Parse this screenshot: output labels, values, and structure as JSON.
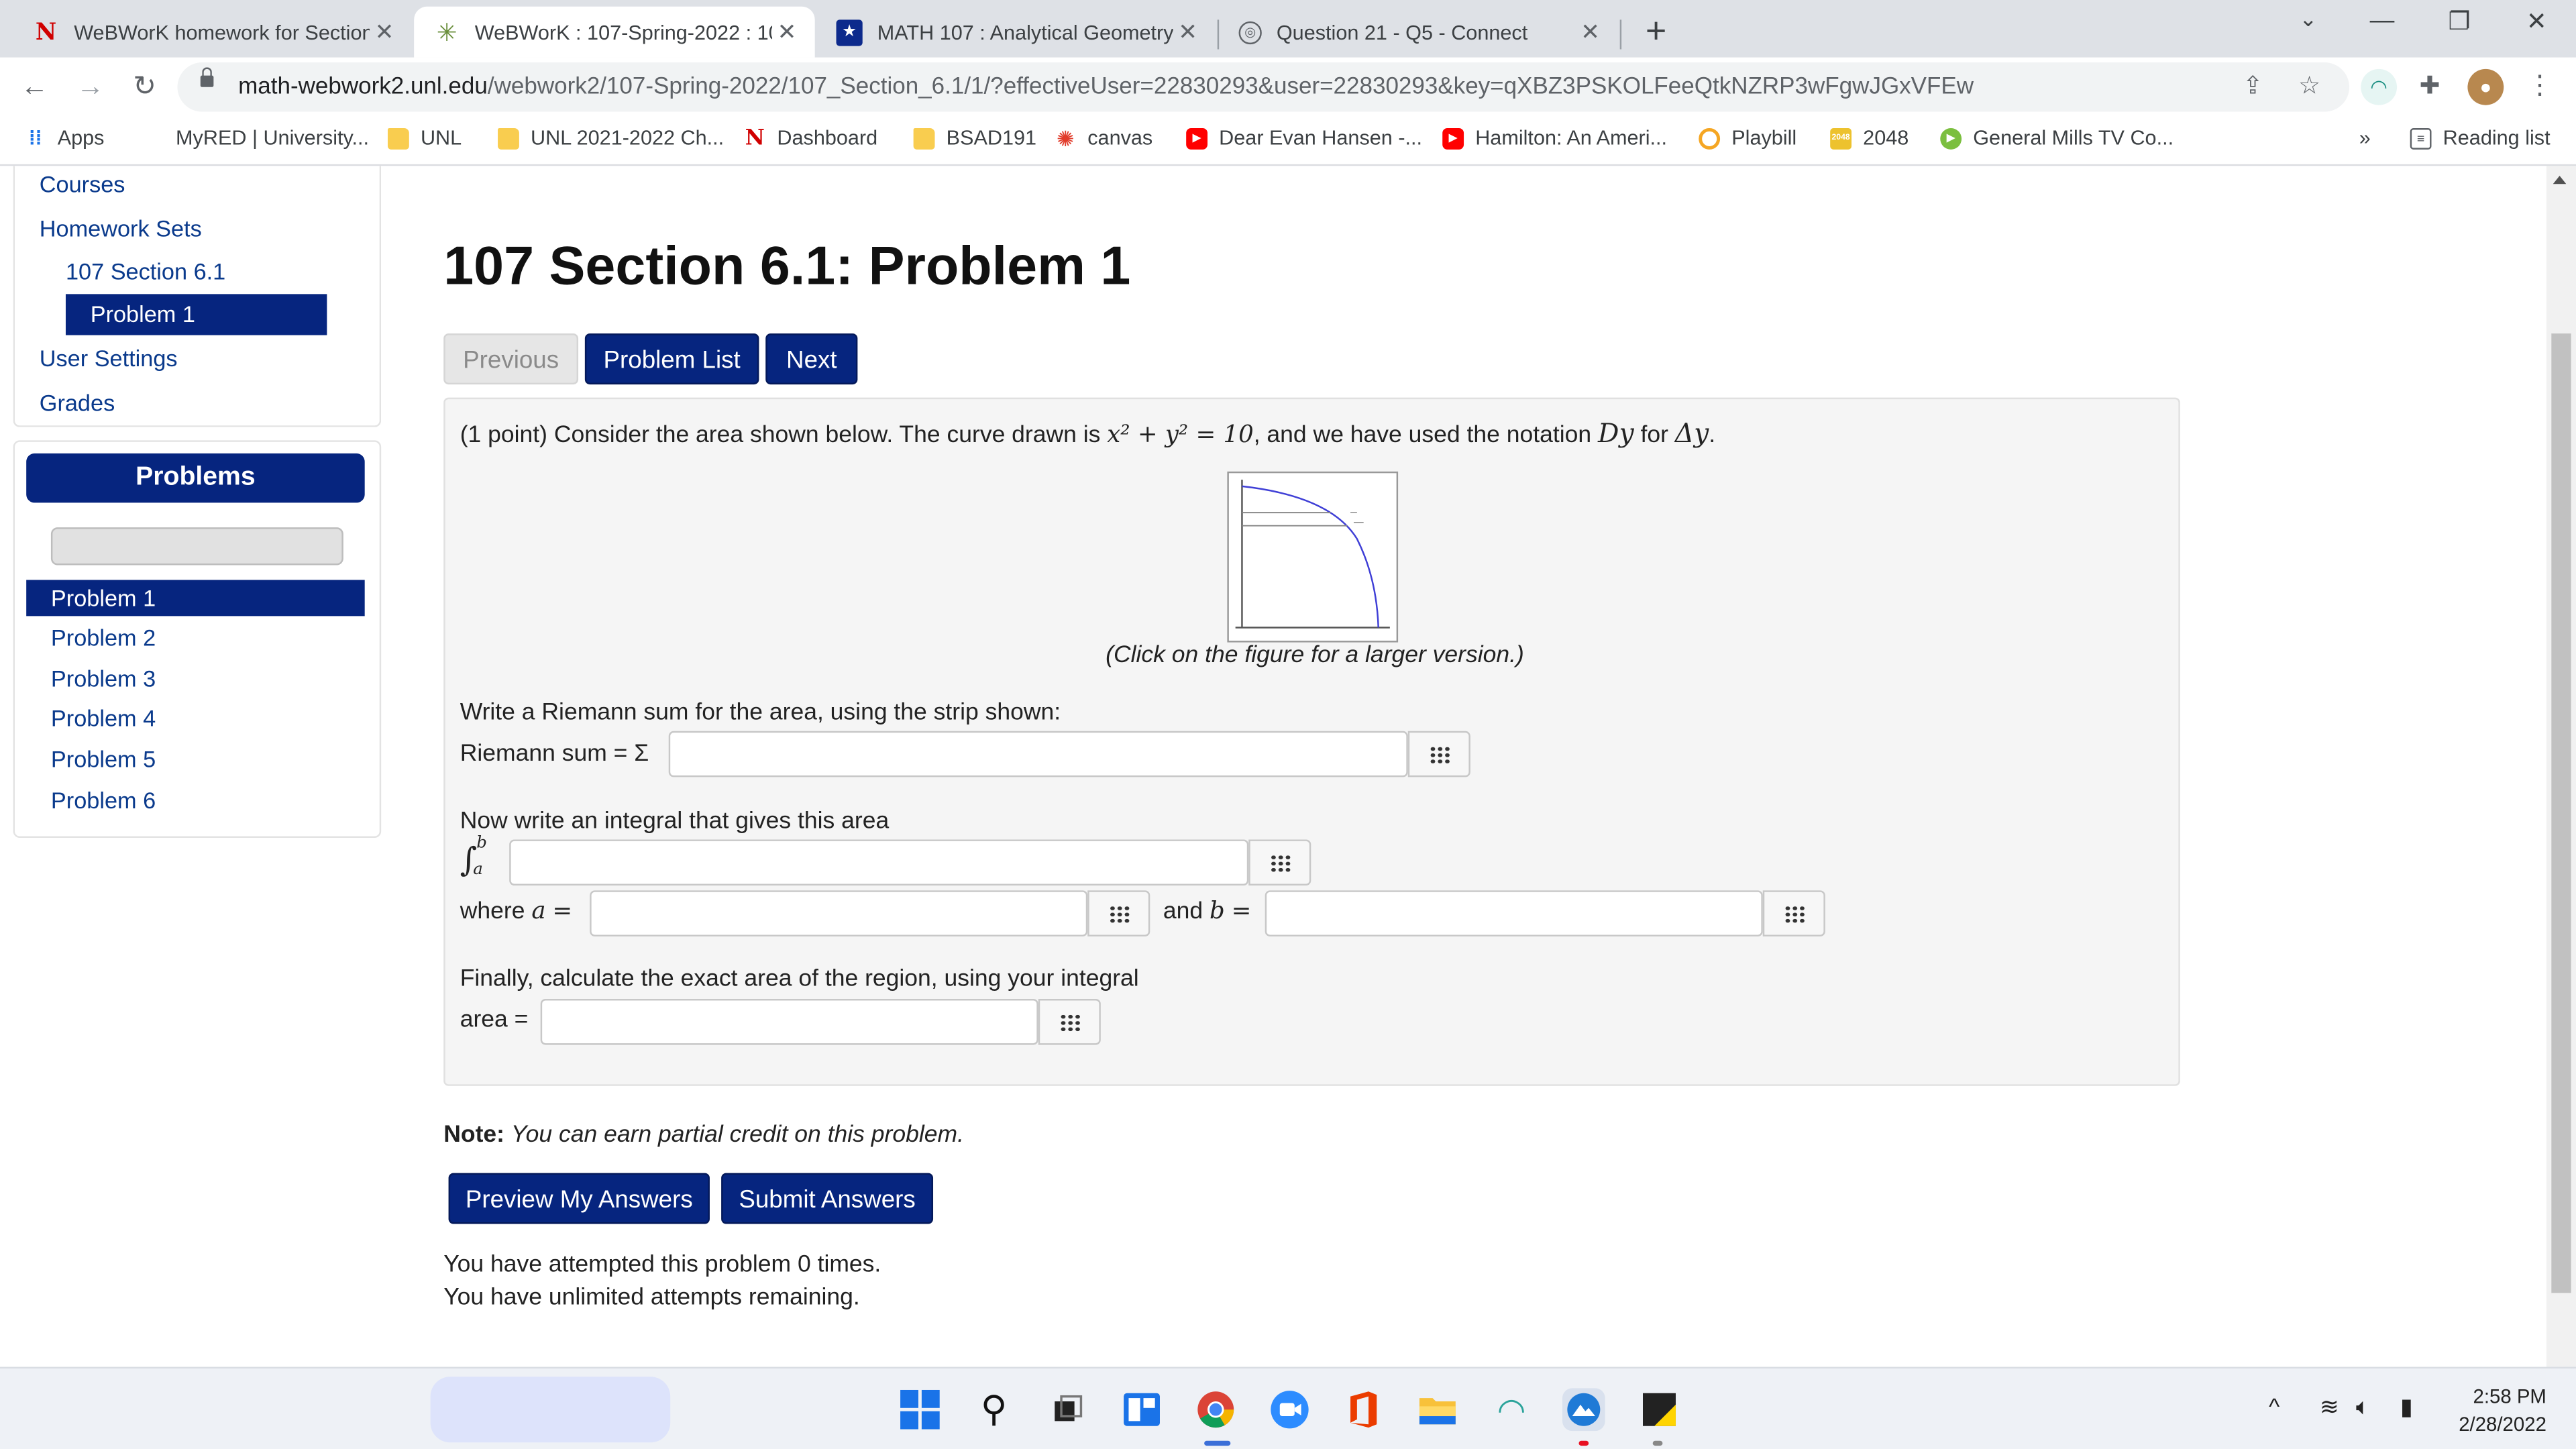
{
  "colors": {
    "nav_blue": "#06257f",
    "link_blue": "#0a3a8c",
    "tab_strip": "#dee1e6"
  },
  "tabs": [
    {
      "title": "WeBWorK homework for Section",
      "icon": "n-logo-icon",
      "active": false
    },
    {
      "title": "WeBWorK : 107-Spring-2022 : 10",
      "icon": "webwork-icon",
      "active": true
    },
    {
      "title": "MATH 107 : Analytical Geometry",
      "icon": "star-badge-icon",
      "active": false
    },
    {
      "title": "Question 21 - Q5 - Connect",
      "icon": "globe-icon",
      "active": false
    }
  ],
  "address": {
    "host": "math-webwork2.unl.edu",
    "path": "/webwork2/107-Spring-2022/107_Section_6.1/1/?effectiveUser=22830293&user=22830293&key=qXBZ3PSKOLFeeQtkNZRP3wFgwJGxVFEw"
  },
  "bookmarks": {
    "apps": "Apps",
    "items": [
      "MyRED | University...",
      "UNL",
      "UNL 2021-2022 Ch...",
      "Dashboard",
      "BSAD191",
      "canvas",
      "Dear Evan Hansen -...",
      "Hamilton: An Ameri...",
      "Playbill",
      "2048",
      "General Mills TV Co..."
    ],
    "more": "»",
    "reading_list": "Reading list"
  },
  "sidebar": {
    "courses": "Courses",
    "homework_sets": "Homework Sets",
    "section": "107 Section 6.1",
    "problem": "Problem 1",
    "user_settings": "User Settings",
    "grades": "Grades"
  },
  "problems_panel": {
    "heading": "Problems",
    "items": [
      "Problem 1",
      "Problem 2",
      "Problem 3",
      "Problem 4",
      "Problem 5",
      "Problem 6"
    ]
  },
  "main": {
    "title": "107 Section 6.1: Problem 1",
    "prev": "Previous",
    "list": "Problem List",
    "next": "Next",
    "intro_pre": "(1 point) Consider the area shown below. The curve drawn is ",
    "equation": "x² + y² = 10",
    "intro_mid": ", and we have used the notation ",
    "notation_dy": "Dy",
    "intro_for": " for ",
    "notation_delta": "Δy",
    "intro_end": ".",
    "caption": "(Click on the figure for a larger version.)",
    "riemann_prompt": "Write a Riemann sum for the area, using the strip shown:",
    "riemann_label": "Riemann sum = Σ",
    "integral_prompt": "Now write an integral that gives this area",
    "integral_symbol": "∫",
    "upper_limit": "b",
    "lower_limit": "a",
    "where_label": "where",
    "var_a": "a",
    "eq": "=",
    "and_label": "and",
    "var_b": "b",
    "area_prompt": "Finally, calculate the exact area of the region, using your integral",
    "area_label": "area ="
  },
  "note_label": "Note:",
  "note_text": "You can earn partial credit on this problem.",
  "preview_button": "Preview My Answers",
  "submit_button": "Submit Answers",
  "attempts": "You have attempted this problem 0 times.",
  "remaining": "You have unlimited attempts remaining.",
  "taskbar": {
    "time": "2:58 PM",
    "date": "2/28/2022"
  }
}
